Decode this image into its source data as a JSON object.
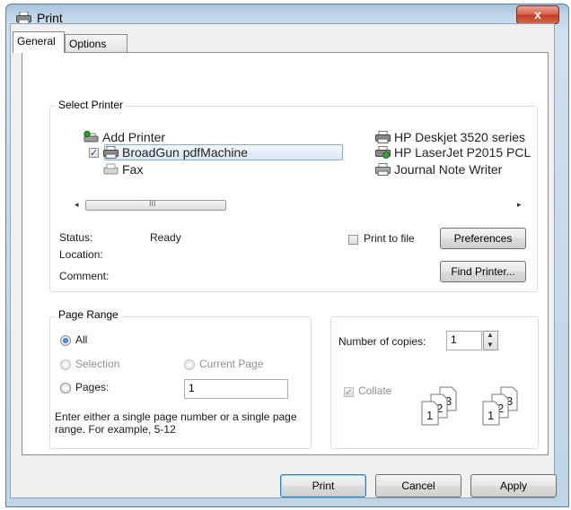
{
  "window": {
    "title": "Print",
    "close_glyph": "x"
  },
  "tabs": [
    {
      "label": "General",
      "active": true
    },
    {
      "label": "Options",
      "active": false
    }
  ],
  "select_printer": {
    "legend": "Select Printer",
    "printers": [
      {
        "name": "Add Printer",
        "icon": "add-printer-icon",
        "selected": false,
        "checked": false
      },
      {
        "name": "BroadGun pdfMachine",
        "icon": "printer-icon",
        "selected": true,
        "checked": true
      },
      {
        "name": "Fax",
        "icon": "fax-icon",
        "selected": false,
        "checked": false
      },
      {
        "name": "HP Deskjet 3520 series",
        "icon": "printer-icon",
        "selected": false,
        "checked": false
      },
      {
        "name": "HP LaserJet P2015 PCL",
        "icon": "network-printer-icon",
        "selected": false,
        "checked": false
      },
      {
        "name": "Journal Note Writer",
        "icon": "printer-icon",
        "selected": false,
        "checked": false
      }
    ],
    "status_label": "Status:",
    "status_value": "Ready",
    "location_label": "Location:",
    "location_value": "",
    "comment_label": "Comment:",
    "comment_value": "",
    "print_to_file_label": "Print to file",
    "print_to_file_checked": false,
    "preferences_label": "Preferences",
    "find_printer_label": "Find Printer..."
  },
  "page_range": {
    "legend": "Page Range",
    "all_label": "All",
    "selection_label": "Selection",
    "current_page_label": "Current Page",
    "pages_label": "Pages:",
    "pages_value": "1",
    "selected": "All",
    "hint": "Enter either a single page number or a single page range.  For example, 5-12"
  },
  "copies": {
    "label": "Number of copies:",
    "value": "1",
    "collate_label": "Collate",
    "collate_checked": true,
    "collate_enabled": false
  },
  "buttons": {
    "print": "Print",
    "cancel": "Cancel",
    "apply": "Apply"
  },
  "colors": {
    "accent": "#3c7fb1",
    "selection": "#dbe8f8",
    "close": "#c23b22"
  }
}
